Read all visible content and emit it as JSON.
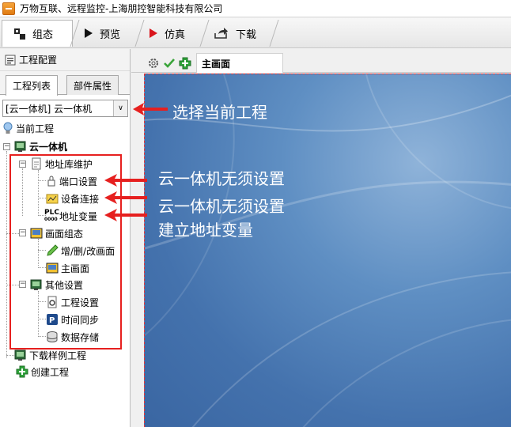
{
  "window": {
    "title": "万物互联、远程监控-上海朋控智能科技有限公司"
  },
  "toolbar": {
    "items": [
      {
        "label": "组态"
      },
      {
        "label": "预览"
      },
      {
        "label": "仿真"
      },
      {
        "label": "下载"
      }
    ]
  },
  "left_panel": {
    "header": "工程配置",
    "tabs": [
      {
        "label": "工程列表"
      },
      {
        "label": "部件属性"
      }
    ],
    "project_select": {
      "value": "[云一体机] 云一体机"
    },
    "tree": {
      "current_project": "当前工程",
      "root": "云一体机",
      "address_lib": "地址库维护",
      "port_settings": "端口设置",
      "device_connect": "设备连接",
      "address_vars": "地址变量",
      "plc_badge": "PLC",
      "screen_config": "画面组态",
      "edit_screens": "增/删/改画面",
      "main_screen": "主画面",
      "other_settings": "其他设置",
      "project_settings": "工程设置",
      "time_sync": "时间同步",
      "data_storage": "数据存储",
      "download_sample": "下载样例工程",
      "create_project": "创建工程"
    }
  },
  "editor": {
    "tab_label": "主画面"
  },
  "annotations": {
    "select_project": "选择当前工程",
    "no_setup_1": "云一体机无须设置",
    "no_setup_2": "云一体机无须设置",
    "create_vars": "建立地址变量"
  },
  "colors": {
    "annotation_red": "#e6201f",
    "canvas_blue": "#4472ad"
  }
}
